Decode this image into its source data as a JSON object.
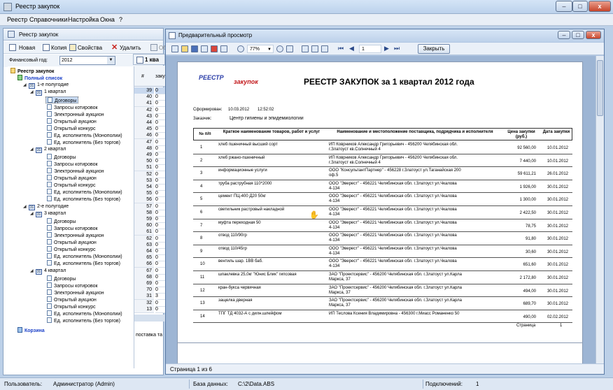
{
  "window": {
    "title": "Реестр закупок",
    "buttons": [
      "–",
      "□",
      "x"
    ]
  },
  "menu": [
    "Реестр",
    "Справочники",
    "Настройка",
    "Окна",
    "?"
  ],
  "left_panel": {
    "title": "Реестр закупок",
    "toolbar": {
      "new": "Новая",
      "copy": "Копия",
      "props": "Свойства",
      "delete": "Удалить",
      "extra": "Об"
    },
    "fiscal_year_label": "Финансовый год:",
    "fiscal_year_value": "2012",
    "tree": {
      "root": "Реестр закупок",
      "full": "Полный список",
      "h1": "1-е полугодие",
      "q1": "1 квартал",
      "q2": "2 квартал",
      "h2": "2-е полугодие",
      "q3": "3 квартал",
      "q4": "4 квартал",
      "items": [
        "Договоры",
        "Запросы котировок",
        "Электронный аукцион",
        "Открытый аукцион",
        "Открытый конкурс",
        "Ед. исполнитель (Монополии)",
        "Ед. исполнитель (Без торгов)"
      ],
      "trash": "Корзина"
    }
  },
  "mid": {
    "tab": "1 ква",
    "col_header": "#",
    "col_header2": "закуп",
    "rows": [
      "39",
      "40",
      "41",
      "42",
      "43",
      "44",
      "45",
      "46",
      "47",
      "48",
      "49",
      "50",
      "51",
      "52",
      "53",
      "54",
      "55",
      "56",
      "57",
      "58",
      "59",
      "60",
      "61",
      "62",
      "63",
      "64",
      "65",
      "66",
      "67",
      "68",
      "69",
      "70",
      "31",
      "32",
      "13"
    ],
    "cells": [
      "0",
      "0",
      "0",
      "0",
      "0",
      "0",
      "0",
      "0",
      "0",
      "0",
      "0",
      "0",
      "0",
      "0",
      "0",
      "0",
      "0",
      "0",
      "0",
      "0",
      "0",
      "0",
      "0",
      "0",
      "0",
      "0",
      "0",
      "0",
      "0",
      "0",
      "0",
      "0",
      "3",
      "0",
      "0"
    ],
    "footer": "поставка та"
  },
  "status": {
    "user_label": "Пользователь:",
    "user_value": "Администратор (Admin)",
    "db_label": "База данных:",
    "db_value": "C:\\2\\Data.ABS",
    "conn_label": "Подключений:",
    "conn_value": "1"
  },
  "preview": {
    "title": "Предварительный просмотр",
    "zoom": "77%",
    "page_input": "1",
    "close_label": "Закрыть",
    "status": "Страница 1 из 6",
    "logo_top": "РЕЕСТР",
    "logo_bottom": "закупок",
    "doc_title": "РЕЕСТР ЗАКУПОК за 1 квартал 2012 года",
    "formed_label": "Сформирован:",
    "formed_date": "10.03.2012",
    "formed_time": "12:52:02",
    "customer_label": "Заказчик:",
    "customer_value": "Центр гигиены и эпидемиологии",
    "headers": {
      "num": "№ п/п",
      "name": "Краткое наименование товаров, работ и услуг",
      "supplier": "Наименование и местоположение поставщика, подрядчика и исполнителя",
      "price": "Цена закупки (руб.)",
      "date": "Дата закупки"
    },
    "rows": [
      {
        "n": "1",
        "name": "хлеб пшеничный высший сорт",
        "sup1": "ИП Коврников Александр Григорьевич - 456200 Челябинская обл.",
        "sup2": "г.Златоуст кв.Солнечный 4",
        "price": "92 560,00",
        "date": "10.01.2012"
      },
      {
        "n": "2",
        "name": "хлеб ржано-пшеничный",
        "sup1": "ИП Коврников Александр Григорьевич - 456200 Челябинская обл.",
        "sup2": "г.Златоуст кв.Солнечный 4",
        "price": "7 440,00",
        "date": "10.01.2012"
      },
      {
        "n": "3",
        "name": "информационные услуги",
        "sup1": "ООО \"КонсультантПартнер\" - 456228 г.Златоуст ул.Таганайская 200",
        "sup2": "оф.5",
        "price": "59 611,21",
        "date": "26.01.2012"
      },
      {
        "n": "4",
        "name": "труба раструбная 110*2000",
        "sup1": "ООО \"Эверест\" - 456221 Челябинская обл. г.Златоуст ул.Чкалова",
        "sup2": "4-134",
        "price": "1 926,00",
        "date": "30.01.2012"
      },
      {
        "n": "5",
        "name": "цемент ПЦ-400 Д20 50кг",
        "sup1": "ООО \"Эверест\" - 456221 Челябинская обл. г.Златоуст ул.Чкалова",
        "sup2": "4-134",
        "price": "1 300,00",
        "date": "30.01.2012"
      },
      {
        "n": "6",
        "name": "светильник растровый накладной",
        "sup1": "ООО \"Эверест\" - 456221 Челябинская обл. г.Златоуст ул.Чкалова",
        "sup2": "4-134",
        "price": "2 422,50",
        "date": "30.01.2012"
      },
      {
        "n": "7",
        "name": "муфта переходная 50",
        "sup1": "ООО \"Эверест\" - 456221 Челябинская обл. г.Златоуст ул.Чкалова",
        "sup2": "4-134",
        "price": "78,75",
        "date": "30.01.2012"
      },
      {
        "n": "8",
        "name": "отвод 110/90гр",
        "sup1": "ООО \"Эверест\" - 456221 Челябинская обл. г.Златоуст ул.Чкалова",
        "sup2": "4-134",
        "price": "91,80",
        "date": "30.01.2012"
      },
      {
        "n": "9",
        "name": "отвод 110/45гр",
        "sup1": "ООО \"Эверест\" - 456221 Челябинская обл. г.Златоуст ул.Чкалова",
        "sup2": "4-134",
        "price": "30,60",
        "date": "30.01.2012"
      },
      {
        "n": "10",
        "name": "вентиль шар. 1ВВ баб.",
        "sup1": "ООО \"Эверест\" - 456221 Челябинская обл. г.Златоуст ул.Чкалова",
        "sup2": "4-134",
        "price": "651,60",
        "date": "30.01.2012"
      },
      {
        "n": "11",
        "name": "шпаклевка 25,0кг \"Юнис Блик\" гипсовая",
        "sup1": "ЗАО \"Проектсервис\" - 456200 Челябинская обл. г.Златоуст ул.Карла",
        "sup2": "Маркса, 37",
        "price": "2 172,80",
        "date": "30.01.2012"
      },
      {
        "n": "12",
        "name": "кран-букса червячная",
        "sup1": "ЗАО \"Проектсервис\" - 456200 Челябинская обл. г.Златоуст ул.Карла",
        "sup2": "Маркса, 37",
        "price": "494,00",
        "date": "30.01.2012"
      },
      {
        "n": "13",
        "name": "защелка дверная",
        "sup1": "ЗАО \"Проектсервис\" - 456200 Челябинская обл. г.Златоуст ул.Карла",
        "sup2": "Маркса, 37",
        "price": "689,70",
        "date": "30.01.2012"
      },
      {
        "n": "14",
        "name": "ТПГ ТД 4032-А с дилн.шлейфом",
        "sup1": "ИП Теслова Ксения Владимировна - 456300 г.Миасс Романенко 50",
        "sup2": "",
        "price": "490,00",
        "date": "02.02.2012"
      }
    ],
    "page_footer_label": "Страница",
    "page_footer_num": "1"
  }
}
